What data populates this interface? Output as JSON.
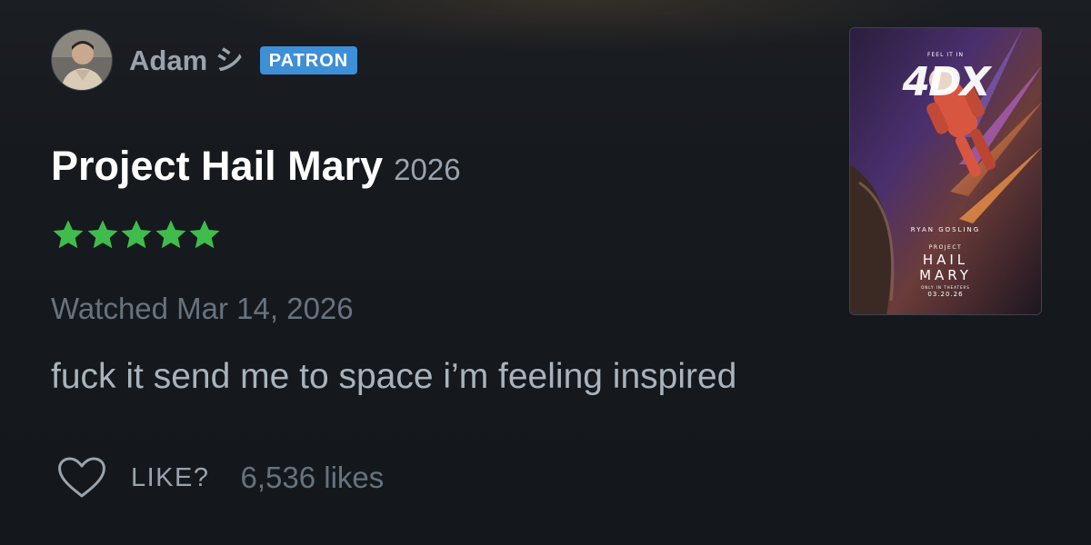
{
  "review": {
    "user": {
      "name": "Adam シ",
      "badge": "PATRON",
      "avatar_icon": "user-avatar-photo"
    },
    "film": {
      "title": "Project Hail Mary",
      "year": "2026"
    },
    "rating": {
      "stars": 5,
      "max": 5,
      "color": "#40bc4c"
    },
    "watched_text": "Watched Mar 14, 2026",
    "body": "fuck it send me to space i’m feeling inspired",
    "likes": {
      "button_label": "LIKE?",
      "count_text": "6,536 likes",
      "icon": "heart-outline-icon"
    },
    "poster": {
      "top_line": "FEEL IT IN",
      "format": "4DX",
      "actor": "RYAN GOSLING",
      "title_small": "PROJECT",
      "title_line1": "HAIL",
      "title_line2": "MARY",
      "tag": "ONLY IN THEATERS",
      "date": "03.20.26"
    }
  },
  "colors": {
    "background": "#14181c",
    "badge": "#3d8fd6",
    "star": "#40bc4c",
    "muted_text": "#67737f",
    "secondary_text": "#9aa3ad"
  }
}
